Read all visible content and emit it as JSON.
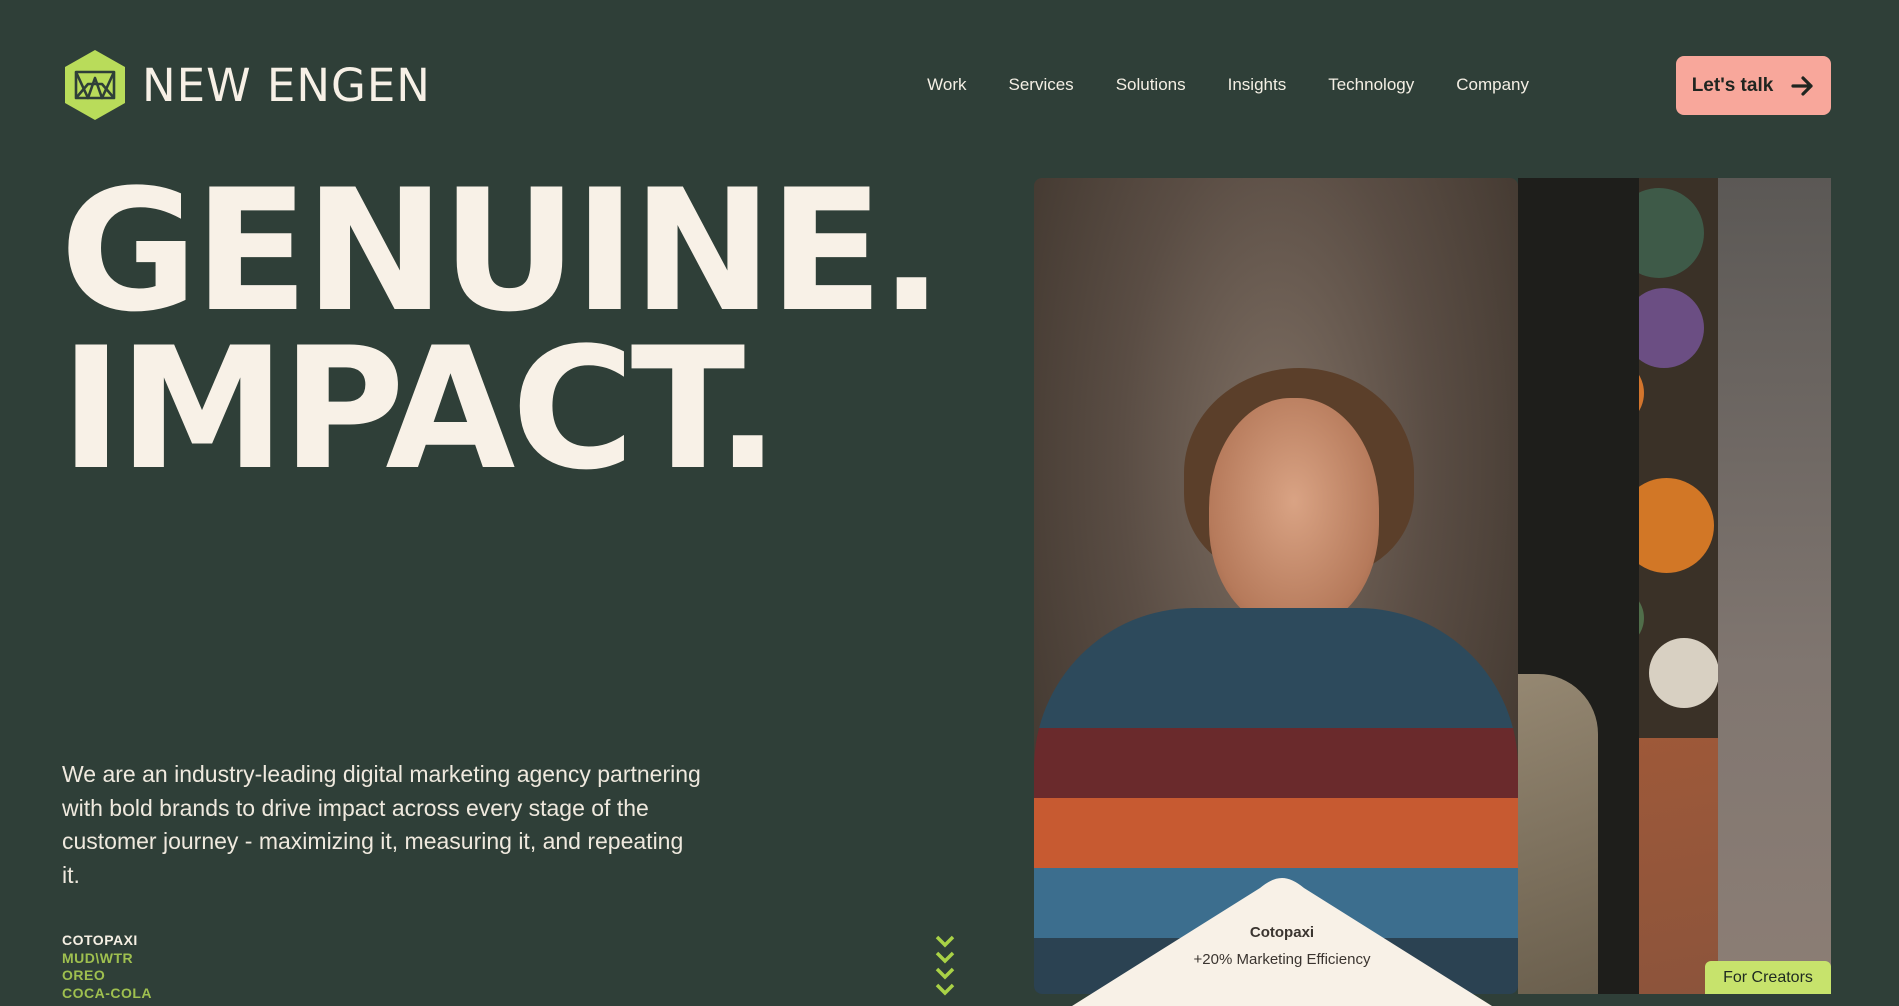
{
  "header": {
    "logo_text": "NEW ENGEN",
    "logo_icon": "hexagon-logo-icon",
    "nav": [
      "Work",
      "Services",
      "Solutions",
      "Insights",
      "Technology",
      "Company"
    ],
    "cta_label": "Let's talk",
    "cta_icon": "arrow-right-icon"
  },
  "hero": {
    "line1": "GENUINE.",
    "line2": "IMPACT."
  },
  "description": "We are an industry-leading digital marketing agency partnering with bold brands to drive impact across every stage of the customer journey - maximizing it, measuring it, and repeating it.",
  "brands": {
    "items": [
      "COTOPAXI",
      "MUD\\WTR",
      "OREO",
      "COCA-COLA"
    ]
  },
  "featured": {
    "title": "Cotopaxi",
    "stat": "+20% Marketing Efficiency"
  },
  "for_creators_label": "For Creators",
  "colors": {
    "background": "#2f3f38",
    "accent_lime": "#c7e36c",
    "cta": "#f8a79b",
    "text": "#f8f1e7"
  }
}
